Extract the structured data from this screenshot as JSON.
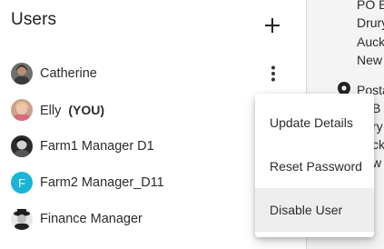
{
  "users_panel": {
    "title": "Users",
    "add_icon": "plus-icon",
    "users": [
      {
        "name": "Catherine",
        "tag": "",
        "avatar": "photo"
      },
      {
        "name": "Elly",
        "tag": "(YOU)",
        "avatar": "photo"
      },
      {
        "name": "Farm1 Manager D1",
        "tag": "",
        "avatar": "photo"
      },
      {
        "name": "Farm2 Manager_D11",
        "tag": "",
        "avatar": "letter",
        "avatar_letter": "F",
        "avatar_color": "#1ab4d7"
      },
      {
        "name": "Finance Manager",
        "tag": "",
        "avatar": "photo"
      }
    ]
  },
  "address_panel": {
    "lines_top": [
      "PO B",
      "Drury",
      "Auck",
      "New"
    ],
    "postal_label": "Posta",
    "lines_bottom": [
      "B",
      "ry",
      "ck",
      "w"
    ],
    "pin_icon": "location-pin-icon"
  },
  "context_menu": {
    "items": [
      {
        "label": "Update Details"
      },
      {
        "label": "Reset Password"
      },
      {
        "label": "Disable User",
        "active": true
      }
    ]
  },
  "colors": {
    "accent_avatar": "#1ab4d7",
    "menu_hover": "#eeeeee",
    "text": "#212121"
  }
}
